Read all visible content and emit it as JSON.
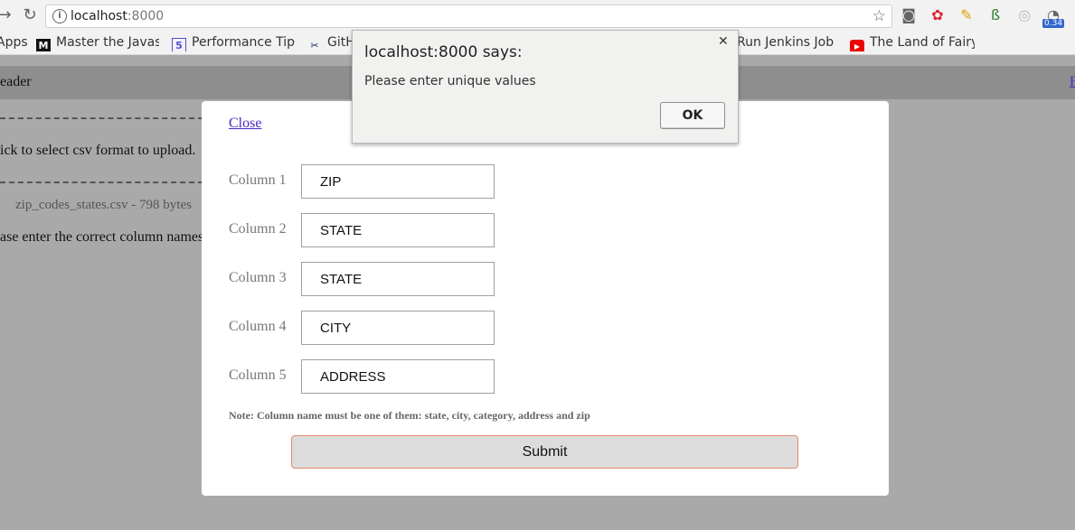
{
  "browser": {
    "url_host": "localhost",
    "url_port": ":8000",
    "extension_badge": "0.34"
  },
  "bookmarks": [
    {
      "label": "Apps",
      "icon": "apps-icon"
    },
    {
      "label": "Master the Javas",
      "icon": "medium-icon",
      "icon_text": "M"
    },
    {
      "label": "Performance Tip",
      "icon": "html5-icon",
      "icon_text": "5"
    },
    {
      "label": "GitH",
      "icon": "tools-icon"
    },
    {
      "label": "Run Jenkins Job",
      "icon": "jenkins-icon"
    },
    {
      "label": "The Land of Fairy",
      "icon": "youtube-icon"
    }
  ],
  "page": {
    "header_title": "eader",
    "header_link": "F",
    "instruction": "ick to select csv format to upload.",
    "file_info": "zip_codes_states.csv - 798 bytes",
    "column_prompt": "ase enter the correct column names"
  },
  "modal": {
    "close_label": "Close",
    "columns": [
      {
        "label": "Column 1",
        "value": "ZIP"
      },
      {
        "label": "Column 2",
        "value": "STATE"
      },
      {
        "label": "Column 3",
        "value": "STATE"
      },
      {
        "label": "Column 4",
        "value": "CITY"
      },
      {
        "label": "Column 5",
        "value": "ADDRESS"
      }
    ],
    "note": "Note: Column name must be one of them: state, city, category, address and zip",
    "submit_label": "Submit"
  },
  "alert": {
    "title": "localhost:8000 says:",
    "message": "Please enter unique values",
    "ok_label": "OK"
  },
  "colors": {
    "overlay": "#a9a9a9",
    "modal_bg": "#ffffff",
    "link": "#4a28c8",
    "submit_border": "#e58a6a"
  }
}
